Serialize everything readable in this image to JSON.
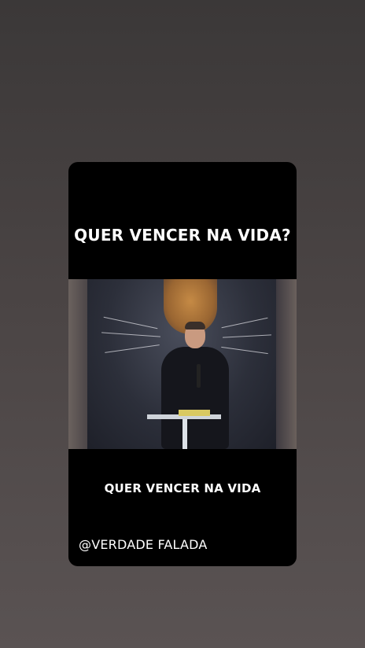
{
  "story": {
    "title": "QUER VENCER NA VIDA?",
    "caption": "QUER VENCER NA VIDA",
    "handle": "@VERDADE FALADA",
    "video_description_icon": "video-frame"
  },
  "colors": {
    "background": "#4a4444",
    "card": "#000000",
    "text": "#ffffff"
  }
}
